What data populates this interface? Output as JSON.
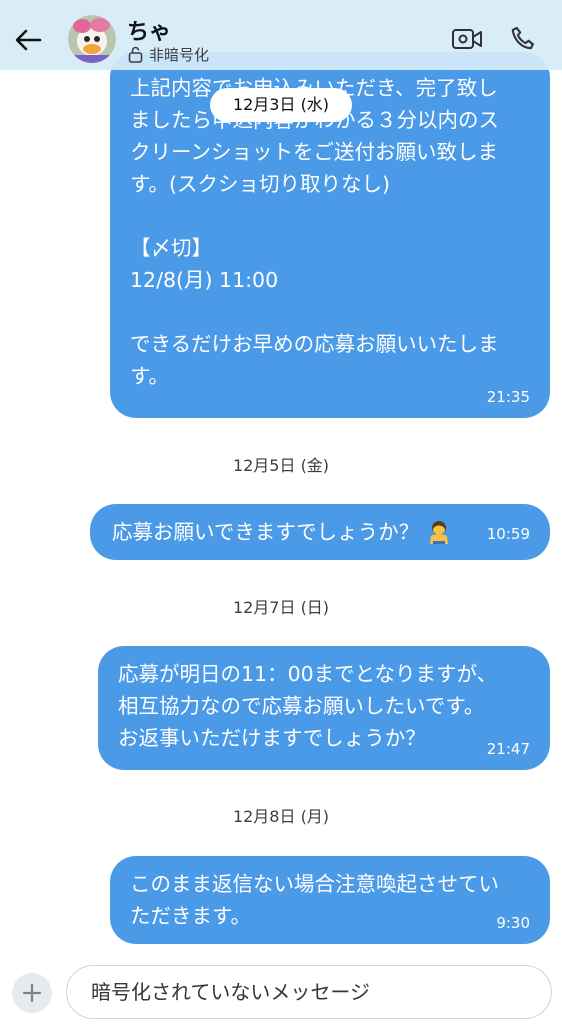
{
  "header": {
    "back_icon": "arrow-left-icon",
    "contact_name": "ちゃ",
    "encryption_status": "非暗号化",
    "lock_icon": "lock-open-icon",
    "video_icon": "video-camera-icon",
    "call_icon": "phone-icon"
  },
  "chat": {
    "floating_date": "12月3日 (水)",
    "messages": [
      {
        "lines": [
          "上記内容でお申込みいただき、完了致し",
          "ましたら申込内容がわかる３分以内のス",
          "クリーンショットをご送付お願い致しま",
          "す。(スクショ切り取りなし)",
          "",
          "【〆切】",
          "12/8(月) 11:00",
          "",
          "できるだけお早めの応募お願いいたしま",
          "す。"
        ],
        "time": "21:35"
      },
      {
        "date": "12月5日 (金)"
      },
      {
        "lines": [
          "応募お願いできますでしょうか？"
        ],
        "emoji_icon": "bowing-person-icon",
        "time": "10:59"
      },
      {
        "date": "12月7日 (日)"
      },
      {
        "lines": [
          "応募が明日の11：00までとなりますが、",
          "相互協力なので応募お願いしたいです。",
          "お返事いただけますでしょうか？"
        ],
        "time": "21:47"
      },
      {
        "date": "12月8日 (月)"
      },
      {
        "lines": [
          "このまま返信ない場合注意喚起させてい",
          "ただきます。"
        ],
        "time": "9:30"
      }
    ]
  },
  "composer": {
    "add_icon": "plus-icon",
    "placeholder": "暗号化されていないメッセージ"
  },
  "colors": {
    "bubble": "#4a9ae8",
    "header_bg": "#d6ecf8"
  }
}
